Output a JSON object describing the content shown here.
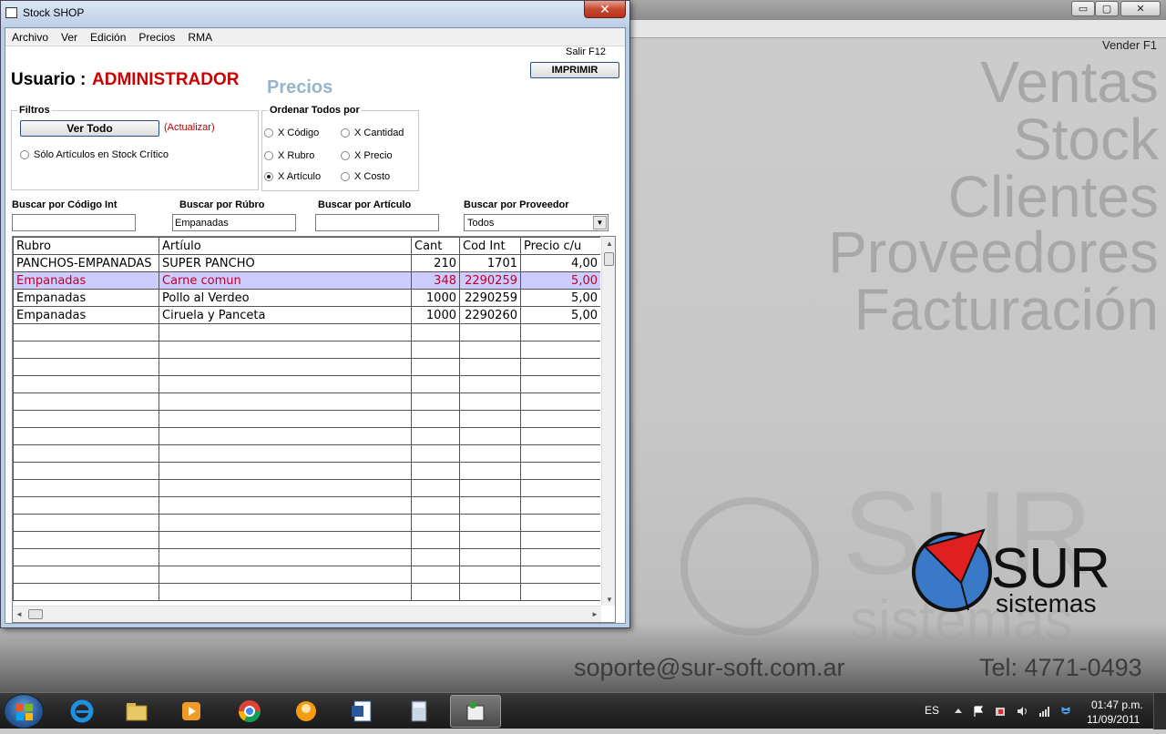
{
  "desktop": {
    "main_app": {
      "window_controls": {
        "minimize": "▭",
        "maximize": "▢",
        "close": "✕"
      },
      "vender_label": "Vender F1",
      "big_menu": [
        "Ventas",
        "Stock",
        "Clientes",
        "Proveedores",
        "Facturación"
      ],
      "logo": {
        "brand": "SUR",
        "sub": "sistemas",
        "watermark_brand": "SUR",
        "watermark_sub": "sistemas"
      },
      "support_email": "soporte@sur-soft.com.ar",
      "support_tel": "Tel: 4771-0493"
    }
  },
  "stock_window": {
    "title": "Stock  SHOP",
    "close_glyph": "✕",
    "menu": [
      "Archivo",
      "Ver",
      "Edición",
      "Precios",
      "RMA"
    ],
    "salir_label": "Salir F12",
    "imprimir_label": "IMPRIMIR",
    "usuario_label": "Usuario :",
    "usuario_value": "ADMINISTRADOR",
    "section_title": "Precios",
    "filtros": {
      "legend": "Filtros",
      "ver_todo_label": "Ver Todo",
      "actualizar_label": "(Actualizar)",
      "stock_critico_label": "Sólo Artículos en Stock Crítico",
      "stock_critico_checked": false
    },
    "ordenar": {
      "legend": "Ordenar Todos por",
      "options": [
        {
          "label": "X Código",
          "checked": false
        },
        {
          "label": "X Cantidad",
          "checked": false
        },
        {
          "label": "X Rubro",
          "checked": false
        },
        {
          "label": "X Precio",
          "checked": false
        },
        {
          "label": "X Artículo",
          "checked": true
        },
        {
          "label": "X Costo",
          "checked": false
        }
      ]
    },
    "search": {
      "codigo_label": "Buscar por Código Int",
      "codigo_value": "",
      "rubro_label": "Buscar por Rúbro",
      "rubro_value": "Empanadas",
      "articulo_label": "Buscar por Artículo",
      "articulo_value": "",
      "proveedor_label": "Buscar por Proveedor",
      "proveedor_value": "Todos",
      "proveedor_arrow": "▼"
    },
    "grid": {
      "columns": [
        "Rubro",
        "Artíulo",
        "Cant",
        "Cod Int",
        "Precio c/u"
      ],
      "rows": [
        {
          "rubro": "PANCHOS-EMPANADAS",
          "articulo": "SUPER PANCHO",
          "cant": "210",
          "cod": "1701",
          "precio": "4,00",
          "selected": false
        },
        {
          "rubro": "Empanadas",
          "articulo": "Carne comun",
          "cant": "348",
          "cod": "2290259",
          "precio": "5,00",
          "selected": true
        },
        {
          "rubro": "Empanadas",
          "articulo": "Pollo al Verdeo",
          "cant": "1000",
          "cod": "2290259",
          "precio": "5,00",
          "selected": false
        },
        {
          "rubro": "Empanadas",
          "articulo": "Ciruela y Panceta",
          "cant": "1000",
          "cod": "2290260",
          "precio": "5,00",
          "selected": false
        }
      ],
      "empty_rows": 16,
      "scroll": {
        "up": "▲",
        "down": "▼",
        "left": "◄",
        "right": "►"
      }
    }
  },
  "taskbar": {
    "items": [
      "ie-icon",
      "explorer-icon",
      "media-player-icon",
      "chrome-icon",
      "messenger-icon",
      "word-icon",
      "calculator-icon",
      "stock-app-icon"
    ],
    "active_item": "stock-app-icon",
    "tray": {
      "language": "ES",
      "time": "01:47 p.m.",
      "date": "11/09/2011"
    }
  },
  "colors": {
    "accent_red": "#cc0000",
    "selected_row_bg": "#ccccff",
    "selected_row_text": "#c0002a",
    "logo_blue": "#3a78c8",
    "logo_red": "#e02020"
  }
}
